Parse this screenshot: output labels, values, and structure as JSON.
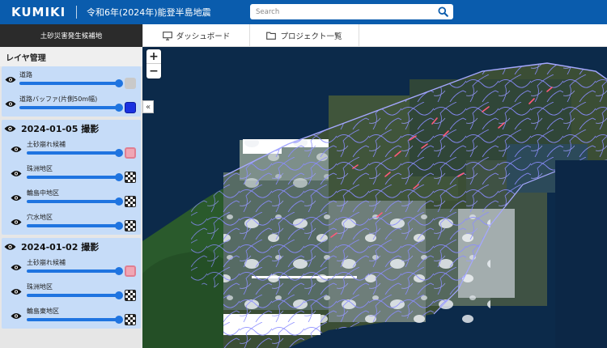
{
  "header": {
    "logo": "KUMIKI",
    "title": "令和6年(2024年)能登半島地震",
    "search_placeholder": "Search"
  },
  "subbar": {
    "left_label": "土砂災害発生候補地",
    "tabs": [
      {
        "label": "ダッシュボード",
        "icon": "monitor-icon"
      },
      {
        "label": "プロジェクト一覧",
        "icon": "folder-icon"
      }
    ]
  },
  "sidebar": {
    "title": "レイヤ管理",
    "base_layers": [
      {
        "label": "道路",
        "color": "#c9c9c9"
      },
      {
        "label": "道路バッファ(片側50m幅)",
        "color": "#1b31e0"
      }
    ],
    "groups": [
      {
        "date": "2024-01-05 撮影",
        "layers": [
          {
            "label": "土砂崩れ候補",
            "swatch": "pink",
            "color": "#f0a6b4"
          },
          {
            "label": "珠洲地区",
            "swatch": "checker"
          },
          {
            "label": "輪島中地区",
            "swatch": "checker"
          },
          {
            "label": "穴水地区",
            "swatch": "checker"
          }
        ]
      },
      {
        "date": "2024-01-02 撮影",
        "layers": [
          {
            "label": "土砂崩れ候補",
            "swatch": "pink",
            "color": "#f0a6b4"
          },
          {
            "label": "珠洲地区",
            "swatch": "checker"
          },
          {
            "label": "輪島東地区",
            "swatch": "checker"
          }
        ]
      }
    ],
    "collapse_symbol": "«"
  },
  "map": {
    "zoom_in": "+",
    "zoom_out": "−"
  },
  "colors": {
    "header": "#0a5cad",
    "panel": "#c6dcf8",
    "slider": "#1f74e0",
    "roads": "#8a8cff",
    "landslide": "#ff5a7a"
  }
}
